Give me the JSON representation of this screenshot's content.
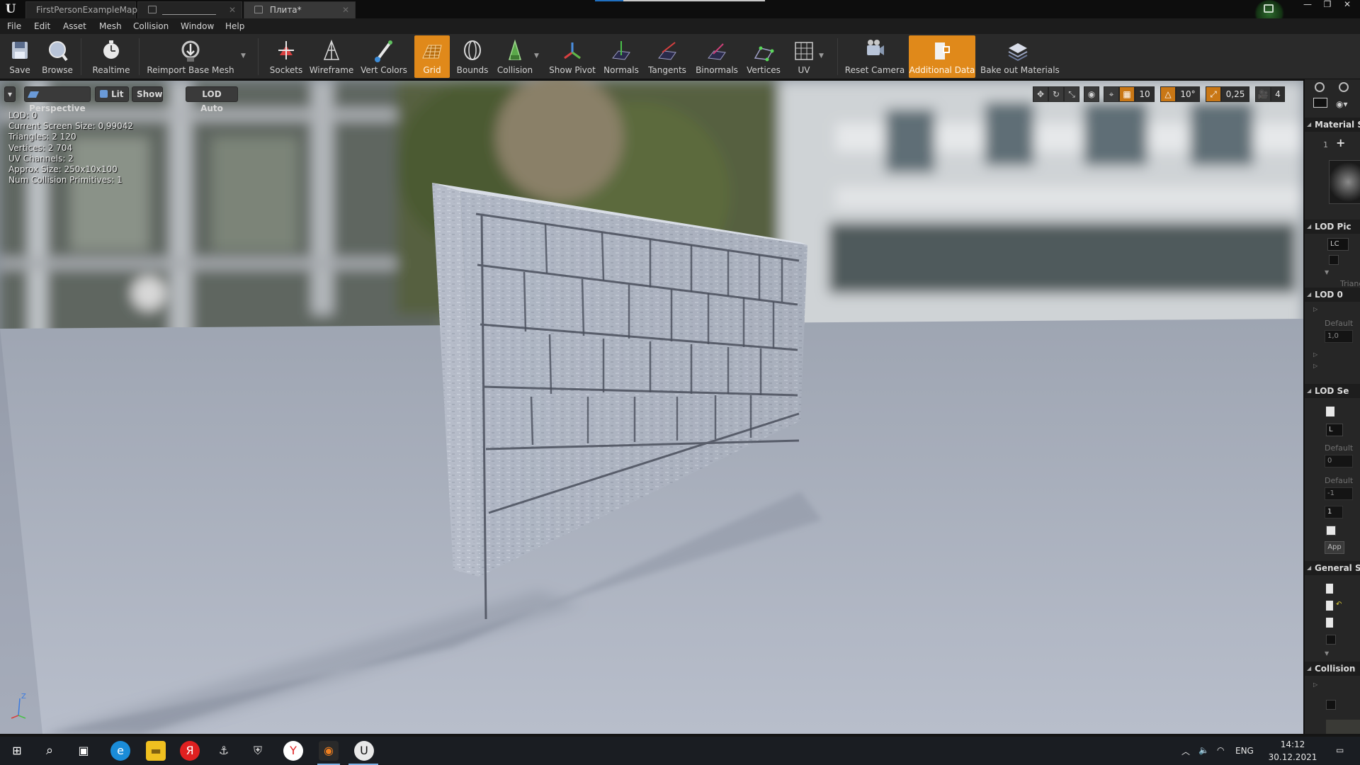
{
  "titlebar": {
    "tabs": [
      {
        "label": "FirstPersonExampleMap*"
      },
      {
        "label": ""
      },
      {
        "label": "Плита*"
      }
    ],
    "window_buttons": {
      "minimize": "—",
      "restore": "❐",
      "close": "✕"
    }
  },
  "menu": {
    "items": [
      "File",
      "Edit",
      "Asset",
      "Mesh",
      "Collision",
      "Window",
      "Help"
    ]
  },
  "toolbar": {
    "buttons": [
      {
        "label": "Save",
        "icon": "save-icon"
      },
      {
        "label": "Browse",
        "icon": "browse-icon"
      },
      {
        "label": "Realtime",
        "icon": "realtime-icon"
      },
      {
        "label": "Reimport Base Mesh",
        "icon": "reimport-icon"
      },
      {
        "label": "Sockets",
        "icon": "sockets-icon"
      },
      {
        "label": "Wireframe",
        "icon": "wireframe-icon"
      },
      {
        "label": "Vert Colors",
        "icon": "vert-colors-icon"
      },
      {
        "label": "Grid",
        "icon": "grid-icon",
        "active": true
      },
      {
        "label": "Bounds",
        "icon": "bounds-icon"
      },
      {
        "label": "Collision",
        "icon": "collision-icon"
      },
      {
        "label": "Show Pivot",
        "icon": "pivot-icon"
      },
      {
        "label": "Normals",
        "icon": "normals-icon"
      },
      {
        "label": "Tangents",
        "icon": "tangents-icon"
      },
      {
        "label": "Binormals",
        "icon": "binormals-icon"
      },
      {
        "label": "Vertices",
        "icon": "vertices-icon"
      },
      {
        "label": "UV",
        "icon": "uv-icon"
      },
      {
        "label": "Reset Camera",
        "icon": "reset-camera-icon"
      },
      {
        "label": "Additional Data",
        "icon": "additional-data-icon",
        "active": true
      },
      {
        "label": "Bake out Materials",
        "icon": "bake-materials-icon"
      }
    ],
    "active_color": "#e0891a"
  },
  "viewport": {
    "menu_arrow": "▾",
    "view_mode": "Perspective",
    "lighting": "Lit",
    "show": "Show",
    "lod": "LOD Auto",
    "grid_snap": "10",
    "rotation_snap": "10°",
    "scale_snap": "0,25",
    "camera_speed": "4",
    "stats": [
      "LOD:  0",
      "Current Screen Size:  0,99042",
      "Triangles:  2 120",
      "Vertices:  2 704",
      "UV Channels:  2",
      "Approx Size: 250x10x100",
      "Num Collision Primitives:  1"
    ],
    "axis": {
      "z": "Z",
      "x": "X",
      "y": "Y"
    }
  },
  "details": {
    "sections": [
      "Material S",
      "LOD Pic",
      "LOD 0",
      "LOD Se",
      "General S",
      "Collision"
    ],
    "material_slot_index": "1",
    "lod_picker_value": "LC",
    "triangles_label": "Triang",
    "lod0_default": "Default",
    "lod0_value": "1,0",
    "lod_settings_default_1": "Default",
    "lod_settings_value_1": "0",
    "lod_settings_default_2": "Default",
    "lod_settings_value_2": "-1",
    "lod_count_value": "1",
    "lod_combo": "L",
    "apply_label": "App"
  },
  "taskbar": {
    "language": "ENG",
    "time": "14:12",
    "date": "30.12.2021"
  }
}
